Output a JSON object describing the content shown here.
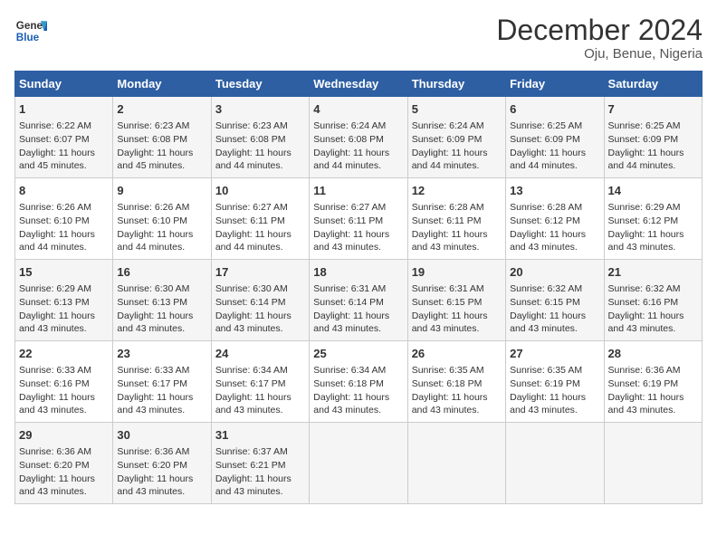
{
  "logo": {
    "line1": "General",
    "line2": "Blue"
  },
  "title": "December 2024",
  "subtitle": "Oju, Benue, Nigeria",
  "days_of_week": [
    "Sunday",
    "Monday",
    "Tuesday",
    "Wednesday",
    "Thursday",
    "Friday",
    "Saturday"
  ],
  "weeks": [
    [
      {
        "day": "1",
        "lines": [
          "Sunrise: 6:22 AM",
          "Sunset: 6:07 PM",
          "Daylight: 11 hours",
          "and 45 minutes."
        ]
      },
      {
        "day": "2",
        "lines": [
          "Sunrise: 6:23 AM",
          "Sunset: 6:08 PM",
          "Daylight: 11 hours",
          "and 45 minutes."
        ]
      },
      {
        "day": "3",
        "lines": [
          "Sunrise: 6:23 AM",
          "Sunset: 6:08 PM",
          "Daylight: 11 hours",
          "and 44 minutes."
        ]
      },
      {
        "day": "4",
        "lines": [
          "Sunrise: 6:24 AM",
          "Sunset: 6:08 PM",
          "Daylight: 11 hours",
          "and 44 minutes."
        ]
      },
      {
        "day": "5",
        "lines": [
          "Sunrise: 6:24 AM",
          "Sunset: 6:09 PM",
          "Daylight: 11 hours",
          "and 44 minutes."
        ]
      },
      {
        "day": "6",
        "lines": [
          "Sunrise: 6:25 AM",
          "Sunset: 6:09 PM",
          "Daylight: 11 hours",
          "and 44 minutes."
        ]
      },
      {
        "day": "7",
        "lines": [
          "Sunrise: 6:25 AM",
          "Sunset: 6:09 PM",
          "Daylight: 11 hours",
          "and 44 minutes."
        ]
      }
    ],
    [
      {
        "day": "8",
        "lines": [
          "Sunrise: 6:26 AM",
          "Sunset: 6:10 PM",
          "Daylight: 11 hours",
          "and 44 minutes."
        ]
      },
      {
        "day": "9",
        "lines": [
          "Sunrise: 6:26 AM",
          "Sunset: 6:10 PM",
          "Daylight: 11 hours",
          "and 44 minutes."
        ]
      },
      {
        "day": "10",
        "lines": [
          "Sunrise: 6:27 AM",
          "Sunset: 6:11 PM",
          "Daylight: 11 hours",
          "and 44 minutes."
        ]
      },
      {
        "day": "11",
        "lines": [
          "Sunrise: 6:27 AM",
          "Sunset: 6:11 PM",
          "Daylight: 11 hours",
          "and 43 minutes."
        ]
      },
      {
        "day": "12",
        "lines": [
          "Sunrise: 6:28 AM",
          "Sunset: 6:11 PM",
          "Daylight: 11 hours",
          "and 43 minutes."
        ]
      },
      {
        "day": "13",
        "lines": [
          "Sunrise: 6:28 AM",
          "Sunset: 6:12 PM",
          "Daylight: 11 hours",
          "and 43 minutes."
        ]
      },
      {
        "day": "14",
        "lines": [
          "Sunrise: 6:29 AM",
          "Sunset: 6:12 PM",
          "Daylight: 11 hours",
          "and 43 minutes."
        ]
      }
    ],
    [
      {
        "day": "15",
        "lines": [
          "Sunrise: 6:29 AM",
          "Sunset: 6:13 PM",
          "Daylight: 11 hours",
          "and 43 minutes."
        ]
      },
      {
        "day": "16",
        "lines": [
          "Sunrise: 6:30 AM",
          "Sunset: 6:13 PM",
          "Daylight: 11 hours",
          "and 43 minutes."
        ]
      },
      {
        "day": "17",
        "lines": [
          "Sunrise: 6:30 AM",
          "Sunset: 6:14 PM",
          "Daylight: 11 hours",
          "and 43 minutes."
        ]
      },
      {
        "day": "18",
        "lines": [
          "Sunrise: 6:31 AM",
          "Sunset: 6:14 PM",
          "Daylight: 11 hours",
          "and 43 minutes."
        ]
      },
      {
        "day": "19",
        "lines": [
          "Sunrise: 6:31 AM",
          "Sunset: 6:15 PM",
          "Daylight: 11 hours",
          "and 43 minutes."
        ]
      },
      {
        "day": "20",
        "lines": [
          "Sunrise: 6:32 AM",
          "Sunset: 6:15 PM",
          "Daylight: 11 hours",
          "and 43 minutes."
        ]
      },
      {
        "day": "21",
        "lines": [
          "Sunrise: 6:32 AM",
          "Sunset: 6:16 PM",
          "Daylight: 11 hours",
          "and 43 minutes."
        ]
      }
    ],
    [
      {
        "day": "22",
        "lines": [
          "Sunrise: 6:33 AM",
          "Sunset: 6:16 PM",
          "Daylight: 11 hours",
          "and 43 minutes."
        ]
      },
      {
        "day": "23",
        "lines": [
          "Sunrise: 6:33 AM",
          "Sunset: 6:17 PM",
          "Daylight: 11 hours",
          "and 43 minutes."
        ]
      },
      {
        "day": "24",
        "lines": [
          "Sunrise: 6:34 AM",
          "Sunset: 6:17 PM",
          "Daylight: 11 hours",
          "and 43 minutes."
        ]
      },
      {
        "day": "25",
        "lines": [
          "Sunrise: 6:34 AM",
          "Sunset: 6:18 PM",
          "Daylight: 11 hours",
          "and 43 minutes."
        ]
      },
      {
        "day": "26",
        "lines": [
          "Sunrise: 6:35 AM",
          "Sunset: 6:18 PM",
          "Daylight: 11 hours",
          "and 43 minutes."
        ]
      },
      {
        "day": "27",
        "lines": [
          "Sunrise: 6:35 AM",
          "Sunset: 6:19 PM",
          "Daylight: 11 hours",
          "and 43 minutes."
        ]
      },
      {
        "day": "28",
        "lines": [
          "Sunrise: 6:36 AM",
          "Sunset: 6:19 PM",
          "Daylight: 11 hours",
          "and 43 minutes."
        ]
      }
    ],
    [
      {
        "day": "29",
        "lines": [
          "Sunrise: 6:36 AM",
          "Sunset: 6:20 PM",
          "Daylight: 11 hours",
          "and 43 minutes."
        ]
      },
      {
        "day": "30",
        "lines": [
          "Sunrise: 6:36 AM",
          "Sunset: 6:20 PM",
          "Daylight: 11 hours",
          "and 43 minutes."
        ]
      },
      {
        "day": "31",
        "lines": [
          "Sunrise: 6:37 AM",
          "Sunset: 6:21 PM",
          "Daylight: 11 hours",
          "and 43 minutes."
        ]
      },
      null,
      null,
      null,
      null
    ]
  ]
}
